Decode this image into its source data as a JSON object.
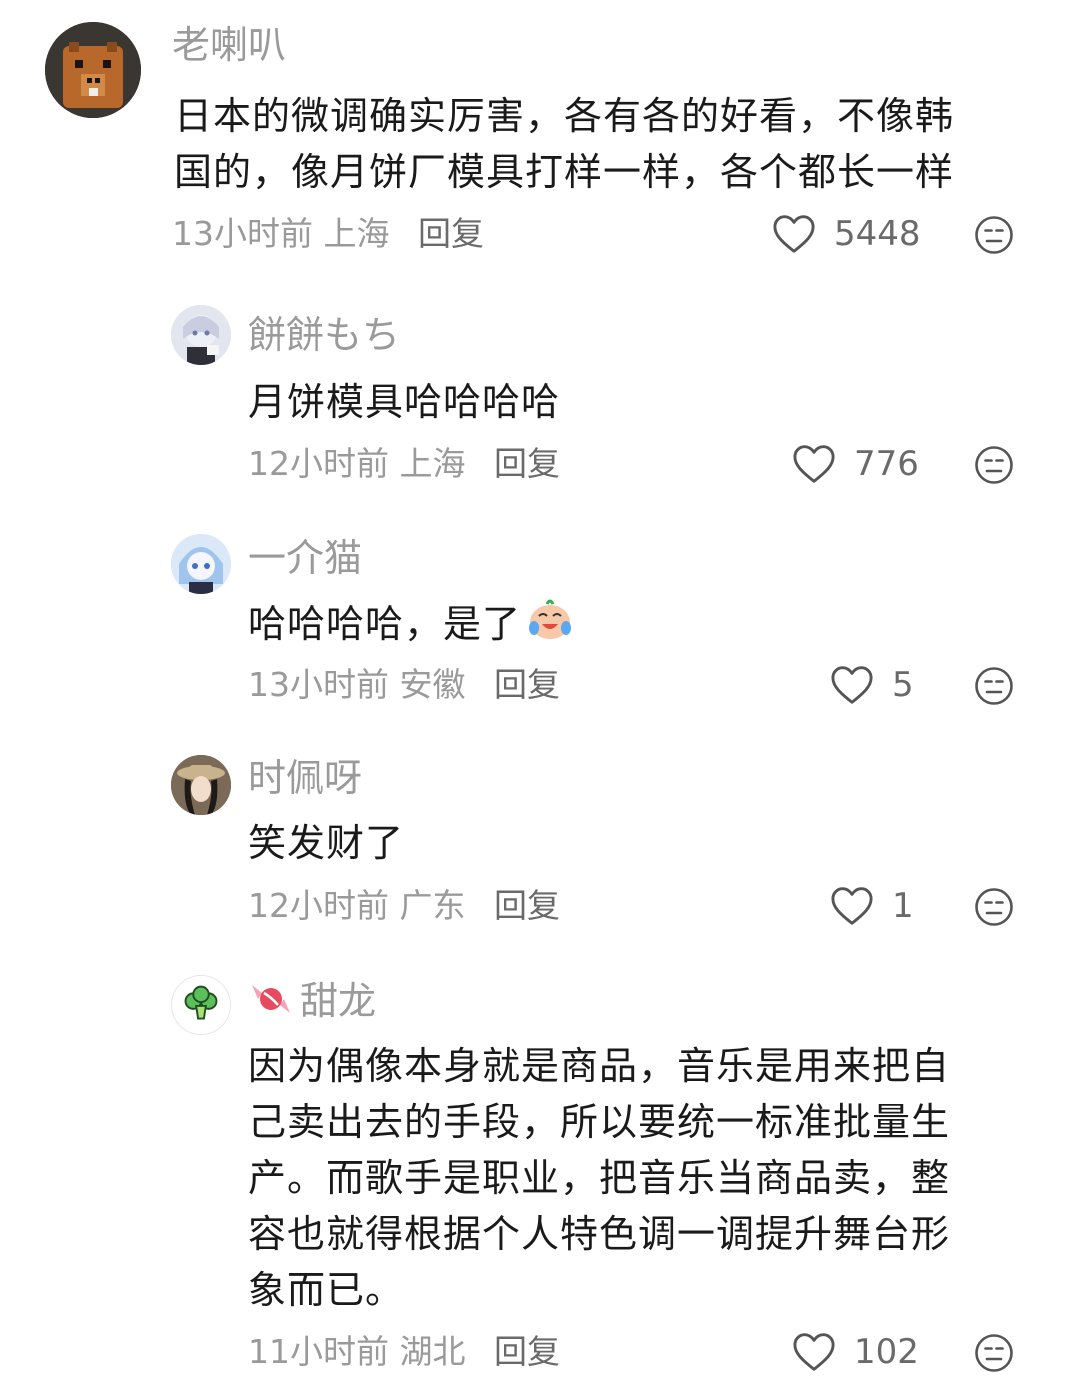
{
  "comments": [
    {
      "name": "老喇叭",
      "text_lines": [
        "日本的微调确实厉害，各有各的好看，不像韩",
        "国的，像月饼厂模具打样一样，各个都长一样"
      ],
      "time": "13小时前",
      "location": "上海",
      "reply": "回复",
      "likes": "5448"
    },
    {
      "name": "餅餅もち",
      "text": "月饼模具哈哈哈哈",
      "time": "12小时前",
      "location": "上海",
      "reply": "回复",
      "likes": "776"
    },
    {
      "name": "一介猫",
      "text": "哈哈哈哈，是了",
      "time": "13小时前",
      "location": "安徽",
      "reply": "回复",
      "likes": "5"
    },
    {
      "name": "时佩呀",
      "text": "笑发财了",
      "time": "12小时前",
      "location": "广东",
      "reply": "回复",
      "likes": "1"
    },
    {
      "name": "甜龙",
      "text_lines": [
        "因为偶像本身就是商品，音乐是用来把自",
        "己卖出去的手段，所以要统一标准批量生",
        "产。而歌手是职业，把音乐当商品卖，整",
        "容也就得根据个人特色调一调提升舞台形",
        "象而已。"
      ],
      "time": "11小时前",
      "location": "湖北",
      "reply": "回复",
      "likes": "102"
    }
  ],
  "icons": {
    "like": "heart-outline-icon",
    "dislike": "meh-face-icon"
  },
  "colors": {
    "secondary_text": "#9a9a9a",
    "primary_text": "#1a1a1a",
    "icon": "#6a6a6a"
  }
}
